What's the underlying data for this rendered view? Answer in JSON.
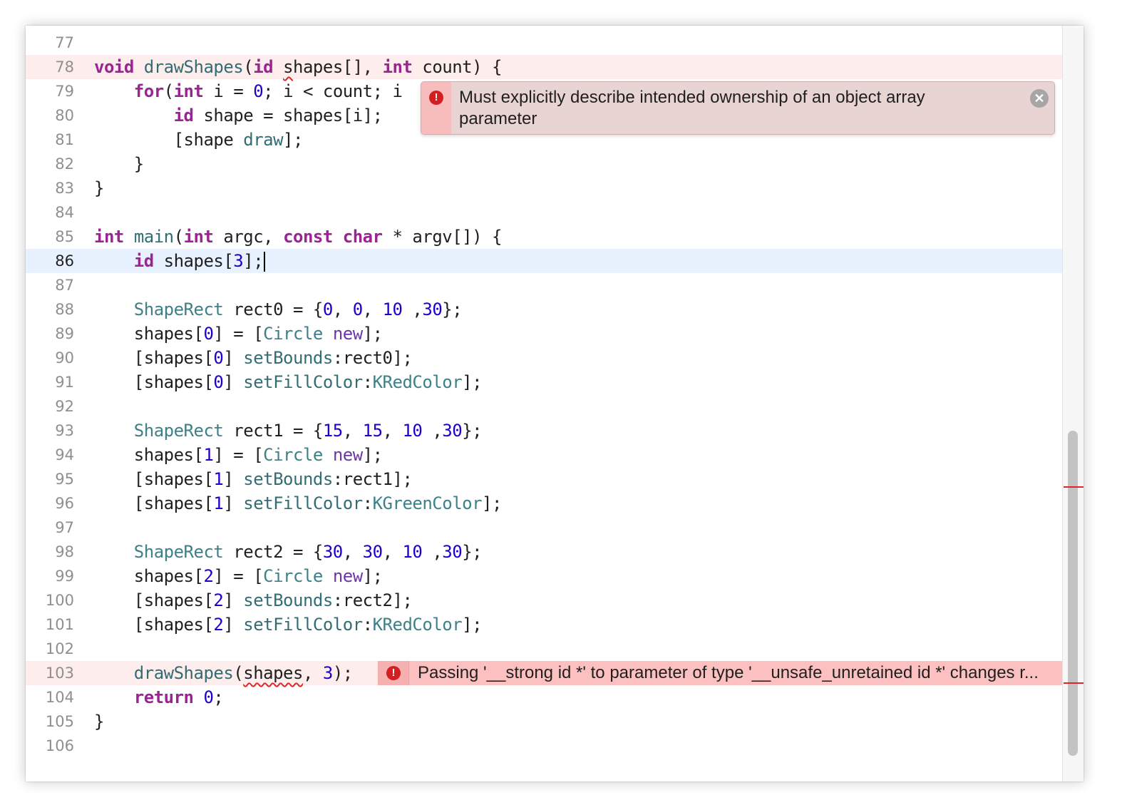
{
  "editor": {
    "current_line": 86,
    "lines": [
      {
        "n": "77",
        "tokens": []
      },
      {
        "n": "78",
        "tokens": [
          [
            "kw",
            "void"
          ],
          [
            "plain",
            " "
          ],
          [
            "fn",
            "drawShapes"
          ],
          [
            "plain",
            "("
          ],
          [
            "kw",
            "id"
          ],
          [
            "plain",
            " "
          ],
          [
            "squig",
            "s"
          ],
          [
            "plain",
            "hapes[], "
          ],
          [
            "kw",
            "int"
          ],
          [
            "plain",
            " count) {"
          ]
        ]
      },
      {
        "n": "79",
        "tokens": [
          [
            "plain",
            "    "
          ],
          [
            "kw",
            "for"
          ],
          [
            "plain",
            "("
          ],
          [
            "kw",
            "int"
          ],
          [
            "plain",
            " i = "
          ],
          [
            "num",
            "0"
          ],
          [
            "plain",
            "; i < count; i"
          ]
        ]
      },
      {
        "n": "80",
        "tokens": [
          [
            "plain",
            "        "
          ],
          [
            "kw",
            "id"
          ],
          [
            "plain",
            " shape = shapes[i];"
          ]
        ]
      },
      {
        "n": "81",
        "tokens": [
          [
            "plain",
            "        [shape "
          ],
          [
            "fn",
            "draw"
          ],
          [
            "plain",
            "];"
          ]
        ]
      },
      {
        "n": "82",
        "tokens": [
          [
            "plain",
            "    }"
          ]
        ]
      },
      {
        "n": "83",
        "tokens": [
          [
            "plain",
            "}"
          ]
        ]
      },
      {
        "n": "84",
        "tokens": []
      },
      {
        "n": "85",
        "tokens": [
          [
            "kw",
            "int"
          ],
          [
            "plain",
            " "
          ],
          [
            "fn",
            "main"
          ],
          [
            "plain",
            "("
          ],
          [
            "kw",
            "int"
          ],
          [
            "plain",
            " argc, "
          ],
          [
            "kw",
            "const"
          ],
          [
            "plain",
            " "
          ],
          [
            "kw",
            "char"
          ],
          [
            "plain",
            " * argv[]) {"
          ]
        ]
      },
      {
        "n": "86",
        "tokens": [
          [
            "plain",
            "    "
          ],
          [
            "kw",
            "id"
          ],
          [
            "plain",
            " shapes["
          ],
          [
            "num",
            "3"
          ],
          [
            "plain",
            "];"
          ]
        ]
      },
      {
        "n": "87",
        "tokens": []
      },
      {
        "n": "88",
        "tokens": [
          [
            "plain",
            "    "
          ],
          [
            "cls",
            "ShapeRect"
          ],
          [
            "plain",
            " rect0 = {"
          ],
          [
            "num",
            "0"
          ],
          [
            "plain",
            ", "
          ],
          [
            "num",
            "0"
          ],
          [
            "plain",
            ", "
          ],
          [
            "num",
            "10"
          ],
          [
            "plain",
            " ,"
          ],
          [
            "num",
            "30"
          ],
          [
            "plain",
            "};"
          ]
        ]
      },
      {
        "n": "89",
        "tokens": [
          [
            "plain",
            "    shapes["
          ],
          [
            "num",
            "0"
          ],
          [
            "plain",
            "] = ["
          ],
          [
            "cls",
            "Circle"
          ],
          [
            "plain",
            " "
          ],
          [
            "msg",
            "new"
          ],
          [
            "plain",
            "];"
          ]
        ]
      },
      {
        "n": "90",
        "tokens": [
          [
            "plain",
            "    [shapes["
          ],
          [
            "num",
            "0"
          ],
          [
            "plain",
            "] "
          ],
          [
            "fn",
            "setBounds"
          ],
          [
            "plain",
            ":rect0];"
          ]
        ]
      },
      {
        "n": "91",
        "tokens": [
          [
            "plain",
            "    [shapes["
          ],
          [
            "num",
            "0"
          ],
          [
            "plain",
            "] "
          ],
          [
            "fn",
            "setFillColor"
          ],
          [
            "plain",
            ":"
          ],
          [
            "cls",
            "KRedColor"
          ],
          [
            "plain",
            "];"
          ]
        ]
      },
      {
        "n": "92",
        "tokens": []
      },
      {
        "n": "93",
        "tokens": [
          [
            "plain",
            "    "
          ],
          [
            "cls",
            "ShapeRect"
          ],
          [
            "plain",
            " rect1 = {"
          ],
          [
            "num",
            "15"
          ],
          [
            "plain",
            ", "
          ],
          [
            "num",
            "15"
          ],
          [
            "plain",
            ", "
          ],
          [
            "num",
            "10"
          ],
          [
            "plain",
            " ,"
          ],
          [
            "num",
            "30"
          ],
          [
            "plain",
            "};"
          ]
        ]
      },
      {
        "n": "94",
        "tokens": [
          [
            "plain",
            "    shapes["
          ],
          [
            "num",
            "1"
          ],
          [
            "plain",
            "] = ["
          ],
          [
            "cls",
            "Circle"
          ],
          [
            "plain",
            " "
          ],
          [
            "msg",
            "new"
          ],
          [
            "plain",
            "];"
          ]
        ]
      },
      {
        "n": "95",
        "tokens": [
          [
            "plain",
            "    [shapes["
          ],
          [
            "num",
            "1"
          ],
          [
            "plain",
            "] "
          ],
          [
            "fn",
            "setBounds"
          ],
          [
            "plain",
            ":rect1];"
          ]
        ]
      },
      {
        "n": "96",
        "tokens": [
          [
            "plain",
            "    [shapes["
          ],
          [
            "num",
            "1"
          ],
          [
            "plain",
            "] "
          ],
          [
            "fn",
            "setFillColor"
          ],
          [
            "plain",
            ":"
          ],
          [
            "cls",
            "KGreenColor"
          ],
          [
            "plain",
            "];"
          ]
        ]
      },
      {
        "n": "97",
        "tokens": []
      },
      {
        "n": "98",
        "tokens": [
          [
            "plain",
            "    "
          ],
          [
            "cls",
            "ShapeRect"
          ],
          [
            "plain",
            " rect2 = {"
          ],
          [
            "num",
            "30"
          ],
          [
            "plain",
            ", "
          ],
          [
            "num",
            "30"
          ],
          [
            "plain",
            ", "
          ],
          [
            "num",
            "10"
          ],
          [
            "plain",
            " ,"
          ],
          [
            "num",
            "30"
          ],
          [
            "plain",
            "};"
          ]
        ]
      },
      {
        "n": "99",
        "tokens": [
          [
            "plain",
            "    shapes["
          ],
          [
            "num",
            "2"
          ],
          [
            "plain",
            "] = ["
          ],
          [
            "cls",
            "Circle"
          ],
          [
            "plain",
            " "
          ],
          [
            "msg",
            "new"
          ],
          [
            "plain",
            "];"
          ]
        ]
      },
      {
        "n": "100",
        "tokens": [
          [
            "plain",
            "    [shapes["
          ],
          [
            "num",
            "2"
          ],
          [
            "plain",
            "] "
          ],
          [
            "fn",
            "setBounds"
          ],
          [
            "plain",
            ":rect2];"
          ]
        ]
      },
      {
        "n": "101",
        "tokens": [
          [
            "plain",
            "    [shapes["
          ],
          [
            "num",
            "2"
          ],
          [
            "plain",
            "] "
          ],
          [
            "fn",
            "setFillColor"
          ],
          [
            "plain",
            ":"
          ],
          [
            "cls",
            "KRedColor"
          ],
          [
            "plain",
            "];"
          ]
        ]
      },
      {
        "n": "102",
        "tokens": []
      },
      {
        "n": "103",
        "tokens": [
          [
            "plain",
            "    "
          ],
          [
            "fn",
            "drawShapes"
          ],
          [
            "plain",
            "("
          ],
          [
            "squig",
            "shapes"
          ],
          [
            "plain",
            ", "
          ],
          [
            "num",
            "3"
          ],
          [
            "plain",
            ");"
          ]
        ]
      },
      {
        "n": "104",
        "tokens": [
          [
            "plain",
            "    "
          ],
          [
            "kw",
            "return"
          ],
          [
            "plain",
            " "
          ],
          [
            "num",
            "0"
          ],
          [
            "plain",
            ";"
          ]
        ]
      },
      {
        "n": "105",
        "tokens": [
          [
            "plain",
            "}"
          ]
        ]
      },
      {
        "n": "106",
        "tokens": []
      }
    ],
    "error_lines": [
      "78",
      "103"
    ]
  },
  "popup": {
    "message": "Must explicitly describe intended ownership of an object array parameter",
    "icon": "error-icon",
    "close_icon": "close-icon",
    "icon_glyph": "!",
    "close_glyph": "✕"
  },
  "inline_error": {
    "message": "Passing '__strong id *' to parameter of type '__unsafe_unretained id *' changes r...",
    "icon": "error-icon",
    "icon_glyph": "!"
  },
  "colors": {
    "keyword": "#9b2393",
    "number": "#1c00cf",
    "function": "#326d74",
    "error": "#d31f1f",
    "current_line": "#e8f2fe",
    "error_line": "#fdeded"
  }
}
